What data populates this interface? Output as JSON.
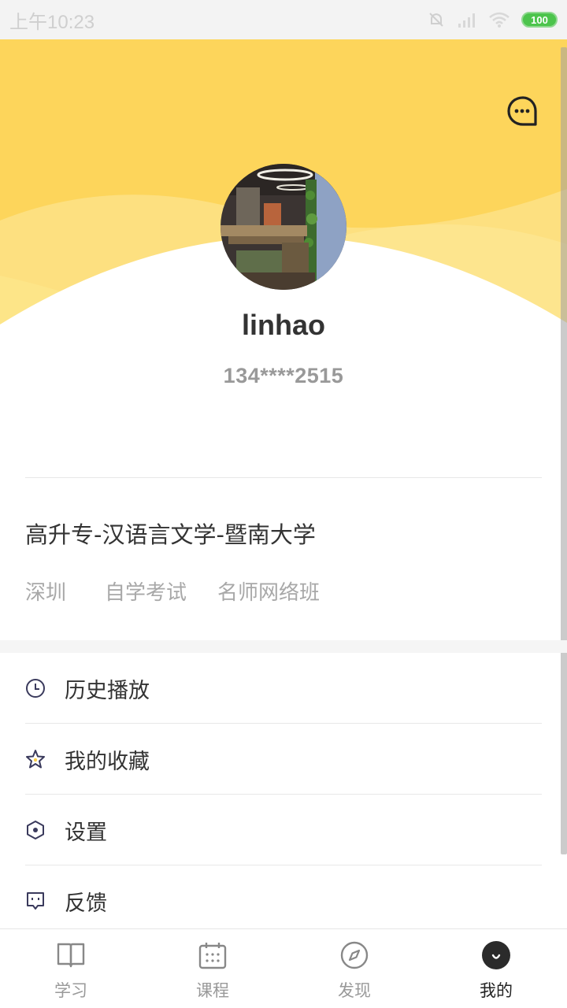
{
  "status_bar": {
    "time": "上午10:23",
    "battery": "100"
  },
  "colors": {
    "header_yellow": "#fdd55b",
    "accent_yellow": "#fbd04a",
    "icon_navy": "#3a3a5c"
  },
  "profile": {
    "username": "linhao",
    "phone": "134****2515",
    "major": "高升专-汉语言文学-暨南大学",
    "tags": {
      "city": "深圳",
      "exam_type": "自学考试",
      "class_type": "名师网络班"
    }
  },
  "menu": {
    "history": "历史播放",
    "favorites": "我的收藏",
    "settings": "设置",
    "feedback": "反馈"
  },
  "tabs": {
    "study": "学习",
    "courses": "课程",
    "discover": "发现",
    "mine": "我的"
  }
}
